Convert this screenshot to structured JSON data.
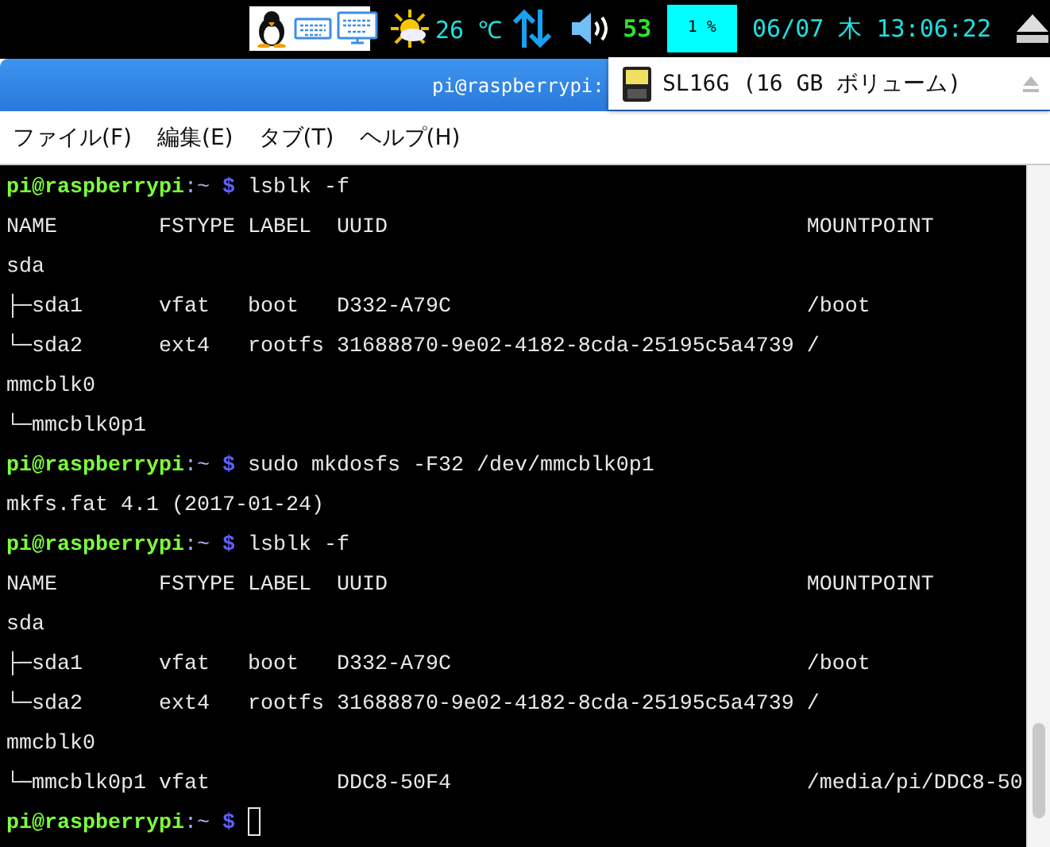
{
  "panel": {
    "temperature": "26 ℃",
    "volume": "53",
    "cpu": "1 %",
    "clock": "06/07 木 13:06:22"
  },
  "window": {
    "title": "pi@raspberrypi:"
  },
  "popup": {
    "items": [
      {
        "label": "SL16G (16 GB ボリューム)"
      }
    ]
  },
  "menu": [
    "ファイル(F)",
    "編集(E)",
    "タブ(T)",
    "ヘルプ(H)"
  ],
  "terminal": {
    "lines": [
      {
        "kind": "prompt",
        "user": "pi@raspberrypi",
        "path": ":~",
        "symbol": "$",
        "command": "lsblk -f"
      },
      {
        "kind": "output",
        "text": "NAME        FSTYPE LABEL  UUID                                 MOUNTPOINT"
      },
      {
        "kind": "output",
        "text": "sda"
      },
      {
        "kind": "output",
        "text": "├─sda1      vfat   boot   D332-A79C                            /boot"
      },
      {
        "kind": "output",
        "text": "└─sda2      ext4   rootfs 31688870-9e02-4182-8cda-25195c5a4739 /"
      },
      {
        "kind": "output",
        "text": "mmcblk0"
      },
      {
        "kind": "output",
        "text": "└─mmcblk0p1"
      },
      {
        "kind": "prompt",
        "user": "pi@raspberrypi",
        "path": ":~",
        "symbol": "$",
        "command": "sudo mkdosfs -F32 /dev/mmcblk0p1"
      },
      {
        "kind": "output",
        "text": "mkfs.fat 4.1 (2017-01-24)"
      },
      {
        "kind": "prompt",
        "user": "pi@raspberrypi",
        "path": ":~",
        "symbol": "$",
        "command": "lsblk -f"
      },
      {
        "kind": "output",
        "text": "NAME        FSTYPE LABEL  UUID                                 MOUNTPOINT"
      },
      {
        "kind": "output",
        "text": "sda"
      },
      {
        "kind": "output",
        "text": "├─sda1      vfat   boot   D332-A79C                            /boot"
      },
      {
        "kind": "output",
        "text": "└─sda2      ext4   rootfs 31688870-9e02-4182-8cda-25195c5a4739 /"
      },
      {
        "kind": "output",
        "text": "mmcblk0"
      },
      {
        "kind": "output",
        "text": "└─mmcblk0p1 vfat          DDC8-50F4                            /media/pi/DDC8-50"
      },
      {
        "kind": "prompt",
        "user": "pi@raspberrypi",
        "path": ":~",
        "symbol": "$",
        "cursor": true
      }
    ]
  }
}
